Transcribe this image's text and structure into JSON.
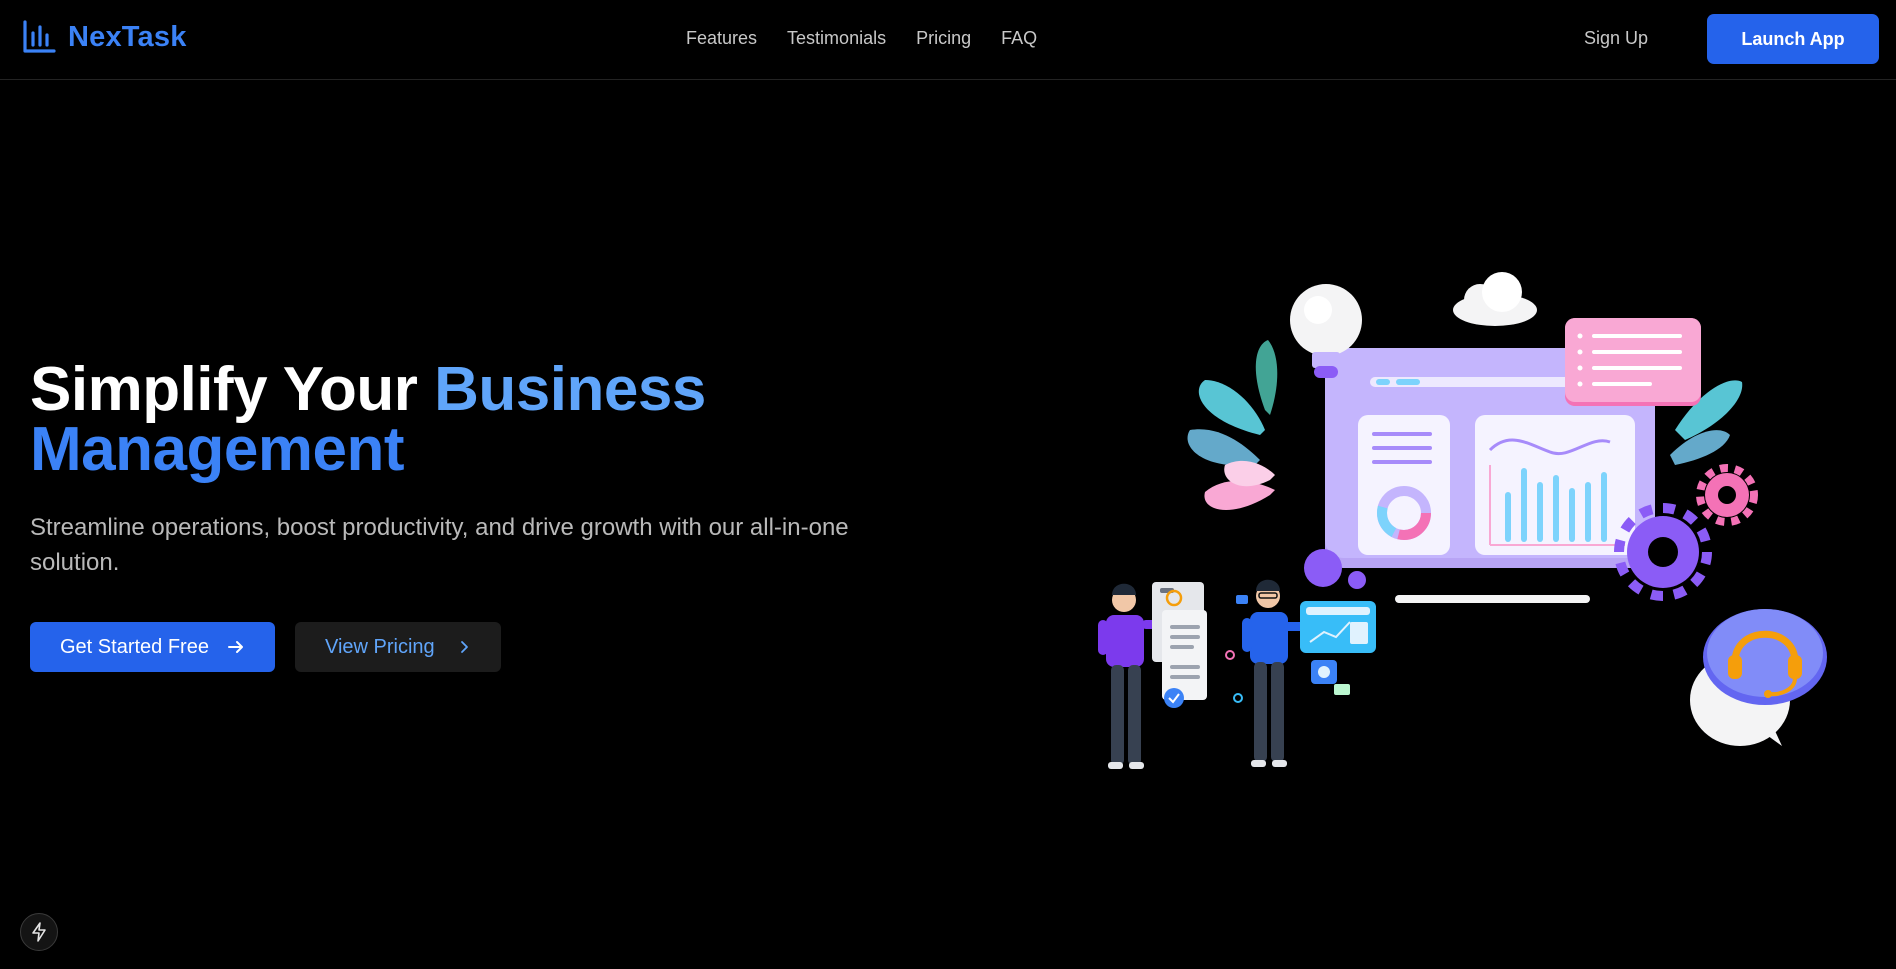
{
  "brand": {
    "name": "NexTask",
    "logo_icon": "bar-chart-icon",
    "accent": "#3b82f6"
  },
  "nav": {
    "links": [
      {
        "label": "Features"
      },
      {
        "label": "Testimonials"
      },
      {
        "label": "Pricing"
      },
      {
        "label": "FAQ"
      }
    ],
    "signup_label": "Sign Up",
    "launch_label": "Launch App"
  },
  "hero": {
    "title_part1": "Simplify Your ",
    "title_part2": "Business",
    "title_part3": "Management",
    "subtitle": "Streamline operations, boost productivity, and drive growth with our all-in-one solution.",
    "primary_cta": "Get Started Free",
    "secondary_cta": "View Pricing"
  },
  "colors": {
    "background": "#000000",
    "primary": "#2563eb",
    "title_blue_light": "#60a5fa",
    "title_blue": "#3b82f6",
    "illustration_purple": "#c4b5fd",
    "illustration_pink": "#f472b6"
  },
  "icons": {
    "arrow_right": "arrow-right-icon",
    "chevron_right": "chevron-right-icon",
    "lightning": "lightning-icon"
  }
}
